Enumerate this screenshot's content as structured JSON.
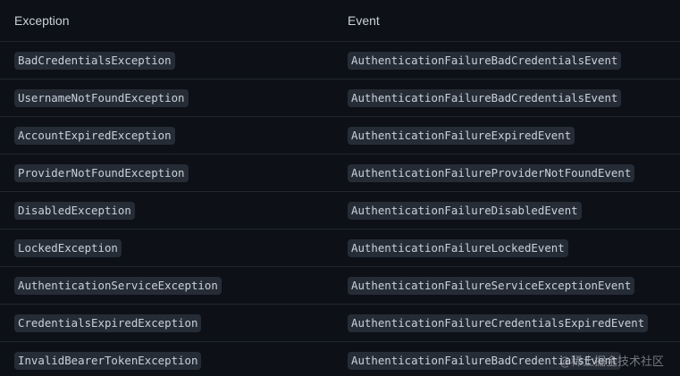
{
  "table": {
    "headers": [
      "Exception",
      "Event"
    ],
    "rows": [
      [
        "BadCredentialsException",
        "AuthenticationFailureBadCredentialsEvent"
      ],
      [
        "UsernameNotFoundException",
        "AuthenticationFailureBadCredentialsEvent"
      ],
      [
        "AccountExpiredException",
        "AuthenticationFailureExpiredEvent"
      ],
      [
        "ProviderNotFoundException",
        "AuthenticationFailureProviderNotFoundEvent"
      ],
      [
        "DisabledException",
        "AuthenticationFailureDisabledEvent"
      ],
      [
        "LockedException",
        "AuthenticationFailureLockedEvent"
      ],
      [
        "AuthenticationServiceException",
        "AuthenticationFailureServiceExceptionEvent"
      ],
      [
        "CredentialsExpiredException",
        "AuthenticationFailureCredentialsExpiredEvent"
      ],
      [
        "InvalidBearerTokenException",
        "AuthenticationFailureBadCredentialsEvent"
      ]
    ]
  },
  "watermark": "@稀土掘金技术社区",
  "colors": {
    "background": "#0d1117",
    "text": "#c9d1d9",
    "code_background": "#262c36",
    "row_border": "#21262d"
  }
}
